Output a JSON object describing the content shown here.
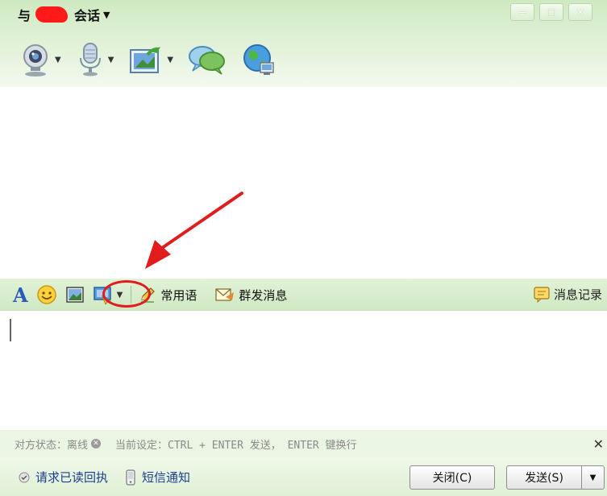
{
  "window": {
    "title_prefix": "与",
    "title_suffix": "会话",
    "title_caret": "▼",
    "minimize": "—",
    "maximize": "□",
    "close": "✕"
  },
  "top_toolbar": {
    "items": [
      {
        "icon": "webcam-icon",
        "has_menu": true
      },
      {
        "icon": "microphone-icon",
        "has_menu": true
      },
      {
        "icon": "transfer-file-icon",
        "has_menu": true
      },
      {
        "icon": "chat-bubbles-icon",
        "has_menu": false
      },
      {
        "icon": "globe-icon",
        "has_menu": false
      }
    ],
    "caret": "▼"
  },
  "input_toolbar": {
    "font_label": "A",
    "phrases_label": "常用语",
    "group_send_label": "群发消息",
    "history_label": "消息记录",
    "caret": "▼"
  },
  "status": {
    "peer_state": "对方状态：离线",
    "offline_mark": "✕",
    "current_setting": "当前设定：CTRL + ENTER 发送， ENTER 键换行",
    "dismiss": "✕"
  },
  "bottom": {
    "read_receipt_label": "请求已读回执",
    "sms_label": "短信通知",
    "close_button": "关闭(C)",
    "send_button": "发送(S)",
    "send_menu": "▼"
  },
  "colors": {
    "header_green": "#cfe9c2",
    "toolbar_green": "#d8eecd",
    "highlight_red": "#e01c1c",
    "link_blue": "#1b3f8e"
  }
}
